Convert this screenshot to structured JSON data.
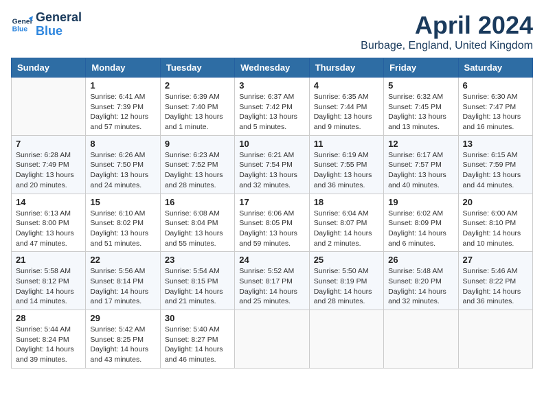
{
  "logo": {
    "line1": "General",
    "line2": "Blue"
  },
  "title": "April 2024",
  "location": "Burbage, England, United Kingdom",
  "weekdays": [
    "Sunday",
    "Monday",
    "Tuesday",
    "Wednesday",
    "Thursday",
    "Friday",
    "Saturday"
  ],
  "weeks": [
    [
      {
        "day": "",
        "info": ""
      },
      {
        "day": "1",
        "info": "Sunrise: 6:41 AM\nSunset: 7:39 PM\nDaylight: 12 hours\nand 57 minutes."
      },
      {
        "day": "2",
        "info": "Sunrise: 6:39 AM\nSunset: 7:40 PM\nDaylight: 13 hours\nand 1 minute."
      },
      {
        "day": "3",
        "info": "Sunrise: 6:37 AM\nSunset: 7:42 PM\nDaylight: 13 hours\nand 5 minutes."
      },
      {
        "day": "4",
        "info": "Sunrise: 6:35 AM\nSunset: 7:44 PM\nDaylight: 13 hours\nand 9 minutes."
      },
      {
        "day": "5",
        "info": "Sunrise: 6:32 AM\nSunset: 7:45 PM\nDaylight: 13 hours\nand 13 minutes."
      },
      {
        "day": "6",
        "info": "Sunrise: 6:30 AM\nSunset: 7:47 PM\nDaylight: 13 hours\nand 16 minutes."
      }
    ],
    [
      {
        "day": "7",
        "info": "Sunrise: 6:28 AM\nSunset: 7:49 PM\nDaylight: 13 hours\nand 20 minutes."
      },
      {
        "day": "8",
        "info": "Sunrise: 6:26 AM\nSunset: 7:50 PM\nDaylight: 13 hours\nand 24 minutes."
      },
      {
        "day": "9",
        "info": "Sunrise: 6:23 AM\nSunset: 7:52 PM\nDaylight: 13 hours\nand 28 minutes."
      },
      {
        "day": "10",
        "info": "Sunrise: 6:21 AM\nSunset: 7:54 PM\nDaylight: 13 hours\nand 32 minutes."
      },
      {
        "day": "11",
        "info": "Sunrise: 6:19 AM\nSunset: 7:55 PM\nDaylight: 13 hours\nand 36 minutes."
      },
      {
        "day": "12",
        "info": "Sunrise: 6:17 AM\nSunset: 7:57 PM\nDaylight: 13 hours\nand 40 minutes."
      },
      {
        "day": "13",
        "info": "Sunrise: 6:15 AM\nSunset: 7:59 PM\nDaylight: 13 hours\nand 44 minutes."
      }
    ],
    [
      {
        "day": "14",
        "info": "Sunrise: 6:13 AM\nSunset: 8:00 PM\nDaylight: 13 hours\nand 47 minutes."
      },
      {
        "day": "15",
        "info": "Sunrise: 6:10 AM\nSunset: 8:02 PM\nDaylight: 13 hours\nand 51 minutes."
      },
      {
        "day": "16",
        "info": "Sunrise: 6:08 AM\nSunset: 8:04 PM\nDaylight: 13 hours\nand 55 minutes."
      },
      {
        "day": "17",
        "info": "Sunrise: 6:06 AM\nSunset: 8:05 PM\nDaylight: 13 hours\nand 59 minutes."
      },
      {
        "day": "18",
        "info": "Sunrise: 6:04 AM\nSunset: 8:07 PM\nDaylight: 14 hours\nand 2 minutes."
      },
      {
        "day": "19",
        "info": "Sunrise: 6:02 AM\nSunset: 8:09 PM\nDaylight: 14 hours\nand 6 minutes."
      },
      {
        "day": "20",
        "info": "Sunrise: 6:00 AM\nSunset: 8:10 PM\nDaylight: 14 hours\nand 10 minutes."
      }
    ],
    [
      {
        "day": "21",
        "info": "Sunrise: 5:58 AM\nSunset: 8:12 PM\nDaylight: 14 hours\nand 14 minutes."
      },
      {
        "day": "22",
        "info": "Sunrise: 5:56 AM\nSunset: 8:14 PM\nDaylight: 14 hours\nand 17 minutes."
      },
      {
        "day": "23",
        "info": "Sunrise: 5:54 AM\nSunset: 8:15 PM\nDaylight: 14 hours\nand 21 minutes."
      },
      {
        "day": "24",
        "info": "Sunrise: 5:52 AM\nSunset: 8:17 PM\nDaylight: 14 hours\nand 25 minutes."
      },
      {
        "day": "25",
        "info": "Sunrise: 5:50 AM\nSunset: 8:19 PM\nDaylight: 14 hours\nand 28 minutes."
      },
      {
        "day": "26",
        "info": "Sunrise: 5:48 AM\nSunset: 8:20 PM\nDaylight: 14 hours\nand 32 minutes."
      },
      {
        "day": "27",
        "info": "Sunrise: 5:46 AM\nSunset: 8:22 PM\nDaylight: 14 hours\nand 36 minutes."
      }
    ],
    [
      {
        "day": "28",
        "info": "Sunrise: 5:44 AM\nSunset: 8:24 PM\nDaylight: 14 hours\nand 39 minutes."
      },
      {
        "day": "29",
        "info": "Sunrise: 5:42 AM\nSunset: 8:25 PM\nDaylight: 14 hours\nand 43 minutes."
      },
      {
        "day": "30",
        "info": "Sunrise: 5:40 AM\nSunset: 8:27 PM\nDaylight: 14 hours\nand 46 minutes."
      },
      {
        "day": "",
        "info": ""
      },
      {
        "day": "",
        "info": ""
      },
      {
        "day": "",
        "info": ""
      },
      {
        "day": "",
        "info": ""
      }
    ]
  ]
}
